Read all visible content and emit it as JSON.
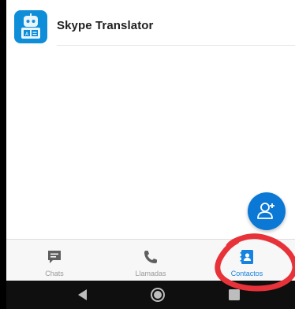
{
  "contacts": [
    {
      "name": "Skype Translator",
      "avatar_icon": "translator-bot-icon"
    }
  ],
  "fab": {
    "icon": "add-contact-icon"
  },
  "bottom_nav": {
    "items": [
      {
        "label": "Chats",
        "icon": "chat-icon",
        "active": false
      },
      {
        "label": "Llamadas",
        "icon": "phone-icon",
        "active": false
      },
      {
        "label": "Contactos",
        "icon": "contacts-icon",
        "active": true
      }
    ]
  },
  "system_nav": {
    "buttons": [
      "back-icon",
      "home-icon",
      "recents-icon"
    ]
  },
  "colors": {
    "accent": "#1683e0",
    "fab": "#0a78d4",
    "highlight": "#e8323a",
    "inactive": "#9a9a9a",
    "avatar": "#0e8ed8"
  }
}
